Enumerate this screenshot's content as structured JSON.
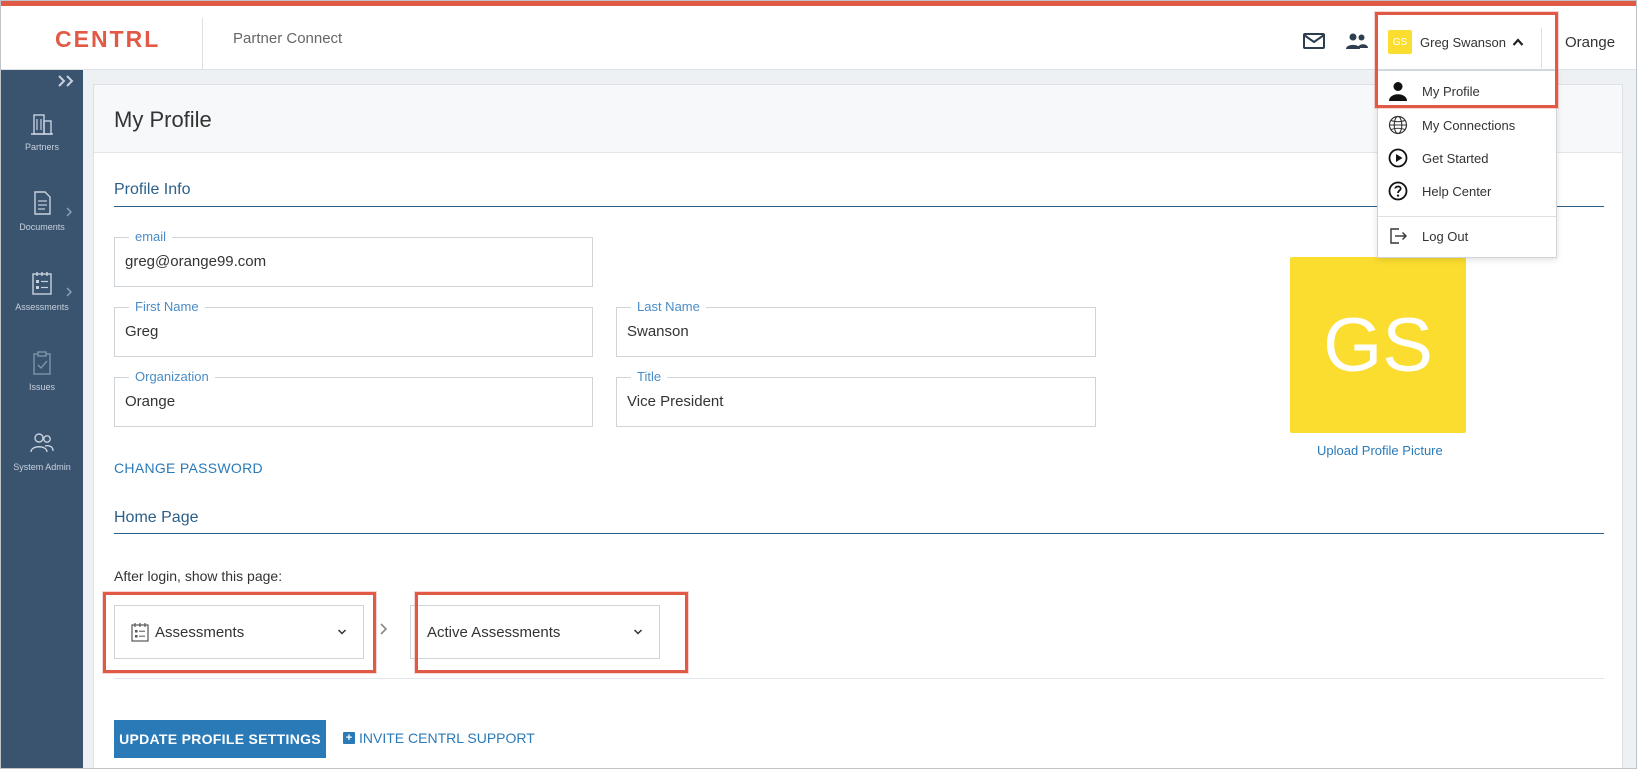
{
  "header": {
    "logo": "CENTRL",
    "app_name": "Partner Connect",
    "user": {
      "initials": "GS",
      "name": "Greg Swanson"
    },
    "organization": "Orange",
    "icons": [
      "mail-icon",
      "people-icon",
      "chevron-up-icon"
    ]
  },
  "sidebar": {
    "items": [
      {
        "label": "Partners",
        "icon": "building-icon"
      },
      {
        "label": "Documents",
        "icon": "document-icon"
      },
      {
        "label": "Assessments",
        "icon": "calendar-checklist-icon"
      },
      {
        "label": "Issues",
        "icon": "clipboard-check-icon"
      },
      {
        "label": "System Admin",
        "icon": "users-gear-icon"
      }
    ]
  },
  "user_menu": {
    "items": [
      {
        "label": "My Profile",
        "icon": "person-icon"
      },
      {
        "label": "My Connections",
        "icon": "globe-icon"
      },
      {
        "label": "Get Started",
        "icon": "play-circle-icon"
      },
      {
        "label": "Help Center",
        "icon": "help-circle-icon"
      },
      {
        "label": "Log Out",
        "icon": "logout-icon"
      }
    ]
  },
  "page": {
    "title": "My Profile",
    "profile_section": "Profile Info",
    "fields": {
      "email": {
        "label": "email",
        "value": "greg@orange99.com"
      },
      "first_name": {
        "label": "First Name",
        "value": "Greg"
      },
      "last_name": {
        "label": "Last Name",
        "value": "Swanson"
      },
      "organization": {
        "label": "Organization",
        "value": "Orange"
      },
      "title": {
        "label": "Title",
        "value": "Vice President"
      }
    },
    "avatar_initials": "GS",
    "upload_picture": "Upload Profile Picture",
    "change_password": "CHANGE PASSWORD",
    "home_section": "Home Page",
    "after_login_label": "After login, show this page:",
    "home_module": "Assessments",
    "home_subpage": "Active Assessments",
    "update_button": "UPDATE PROFILE SETTINGS",
    "invite_support": "INVITE CENTRL SUPPORT"
  },
  "colors": {
    "brand": "#e05a46",
    "sidebar": "#3a5470",
    "accent": "#2a7ab8",
    "avatar": "#fbdd2f",
    "highlight": "#e05a46"
  }
}
